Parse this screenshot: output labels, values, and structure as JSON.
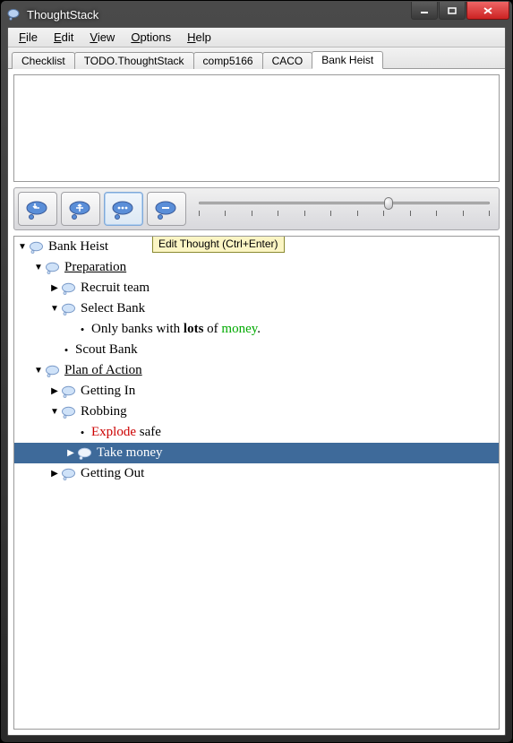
{
  "window": {
    "title": "ThoughtStack"
  },
  "menubar": {
    "items": [
      "File",
      "Edit",
      "View",
      "Options",
      "Help"
    ]
  },
  "tabs": {
    "items": [
      "Checklist",
      "TODO.ThoughtStack",
      "comp5166",
      "CACO",
      "Bank Heist"
    ],
    "active": 4
  },
  "toolbar": {
    "tooltip": "Edit Thought (Ctrl+Enter)",
    "slider": {
      "min": 0,
      "max": 11,
      "value": 7,
      "ticks": 12
    }
  },
  "tree": {
    "nodes": [
      {
        "depth": 0,
        "arrow": "down",
        "icon": "bubble",
        "html": "Bank Heist",
        "selected": false
      },
      {
        "depth": 1,
        "arrow": "down",
        "icon": "bubble",
        "html": "<span class='underline'>Preparation</span>",
        "selected": false
      },
      {
        "depth": 2,
        "arrow": "right",
        "icon": "bubble",
        "html": "Recruit team",
        "selected": false
      },
      {
        "depth": 2,
        "arrow": "down",
        "icon": "bubble",
        "html": "Select Bank",
        "selected": false
      },
      {
        "depth": 3,
        "arrow": "",
        "icon": "bullet",
        "html": "Only banks with <b>lots</b> of <span class='green'>money</span>.",
        "selected": false
      },
      {
        "depth": 2,
        "arrow": "",
        "icon": "bullet",
        "html": "Scout Bank",
        "selected": false
      },
      {
        "depth": 1,
        "arrow": "down",
        "icon": "bubble",
        "html": "<span class='underline'>Plan of Action</span>",
        "selected": false
      },
      {
        "depth": 2,
        "arrow": "right",
        "icon": "bubble",
        "html": "Getting In",
        "selected": false
      },
      {
        "depth": 2,
        "arrow": "down",
        "icon": "bubble",
        "html": "Robbing",
        "selected": false
      },
      {
        "depth": 3,
        "arrow": "",
        "icon": "bullet",
        "html": "<span class='red'>Explode</span> safe",
        "selected": false
      },
      {
        "depth": 3,
        "arrow": "right",
        "icon": "bubble",
        "html": "Take money",
        "selected": true
      },
      {
        "depth": 2,
        "arrow": "right",
        "icon": "bubble",
        "html": "Getting Out",
        "selected": false
      }
    ]
  }
}
